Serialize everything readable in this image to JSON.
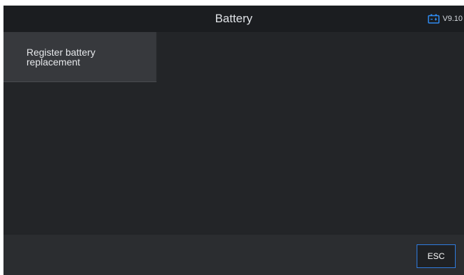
{
  "header": {
    "title": "Battery",
    "version": "V9.10",
    "icon": "battery-icon",
    "icon_color": "#2f8cf2"
  },
  "menu": {
    "items": [
      {
        "label": "Register battery replacement"
      }
    ]
  },
  "footer": {
    "esc_label": "ESC",
    "esc_border_color": "#2f7de1"
  }
}
